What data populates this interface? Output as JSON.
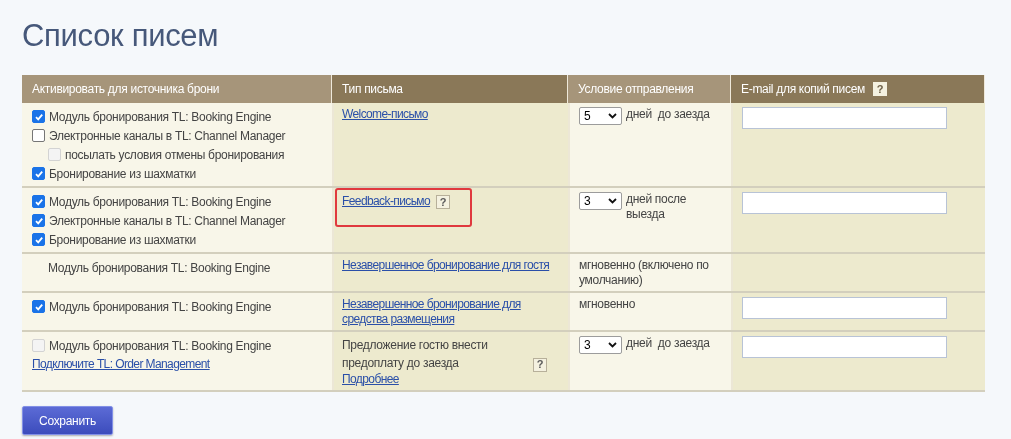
{
  "title": "Список писем",
  "table": {
    "columns": [
      {
        "label": "Активировать для источника брони"
      },
      {
        "label": "Тип письма"
      },
      {
        "label": "Условие отправления"
      },
      {
        "label": "E-mail для копий писем",
        "help": "?"
      }
    ],
    "rows": [
      {
        "sources": [
          {
            "kind": "checkbox",
            "label": "Модуль бронирования TL: Booking Engine",
            "checked": true,
            "disabled": false
          },
          {
            "kind": "checkbox",
            "label": "Электронные каналы в TL: Channel Manager",
            "checked": false,
            "disabled": false,
            "children": [
              {
                "kind": "checkbox",
                "label": "посылать условия отмены бронирования",
                "checked": false,
                "disabled": true
              }
            ]
          },
          {
            "kind": "checkbox",
            "label": "Бронирование из шахматки",
            "checked": true,
            "disabled": false
          }
        ],
        "letter": {
          "highlighted": false,
          "parts": [
            {
              "kind": "link",
              "text": "Welcome-письмо"
            }
          ]
        },
        "condition": {
          "select": "5",
          "text": "дней  до заезда"
        },
        "email_field": true
      },
      {
        "sources": [
          {
            "kind": "checkbox",
            "label": "Модуль бронирования TL: Booking Engine",
            "checked": true,
            "disabled": false
          },
          {
            "kind": "checkbox",
            "label": "Электронные каналы в TL: Channel Manager",
            "checked": true,
            "disabled": false
          },
          {
            "kind": "checkbox",
            "label": "Бронирование из шахматки",
            "checked": true,
            "disabled": false
          }
        ],
        "letter": {
          "highlighted": true,
          "parts": [
            {
              "kind": "link",
              "text": "Feedback-письмо"
            },
            {
              "kind": "help",
              "text": "?"
            }
          ]
        },
        "condition": {
          "select": "3",
          "text": "дней после выезда"
        },
        "email_field": true
      },
      {
        "sources": [
          {
            "kind": "text",
            "label": "Модуль бронирования TL: Booking Engine"
          }
        ],
        "letter": {
          "highlighted": false,
          "parts": [
            {
              "kind": "link",
              "text": "Незавершенное бронирование для гостя"
            }
          ]
        },
        "condition": {
          "text": "мгновенно (включено по умолчанию)"
        },
        "email_field": false
      },
      {
        "sources": [
          {
            "kind": "checkbox",
            "label": "Модуль бронирования TL: Booking Engine",
            "checked": true,
            "disabled": false
          }
        ],
        "letter": {
          "highlighted": false,
          "parts": [
            {
              "kind": "link",
              "text": "Незавершенное бронирование для средства размещения"
            }
          ]
        },
        "condition": {
          "text": "мгновенно"
        },
        "email_field": true
      },
      {
        "sources": [
          {
            "kind": "checkbox",
            "label": "Модуль бронирования TL: Booking Engine",
            "checked": false,
            "disabled": true
          },
          {
            "kind": "link",
            "label": "Подключите TL: Order Management"
          }
        ],
        "letter": {
          "highlighted": false,
          "parts": [
            {
              "kind": "text",
              "text": "Предложение гостю внести предоплату до заезда"
            },
            {
              "kind": "help",
              "text": "?"
            },
            {
              "kind": "block_link",
              "text": "Подробнее"
            }
          ]
        },
        "condition": {
          "select": "3",
          "text": "дней  до заезда"
        },
        "email_field": true
      }
    ]
  },
  "save_button": "Сохранить"
}
